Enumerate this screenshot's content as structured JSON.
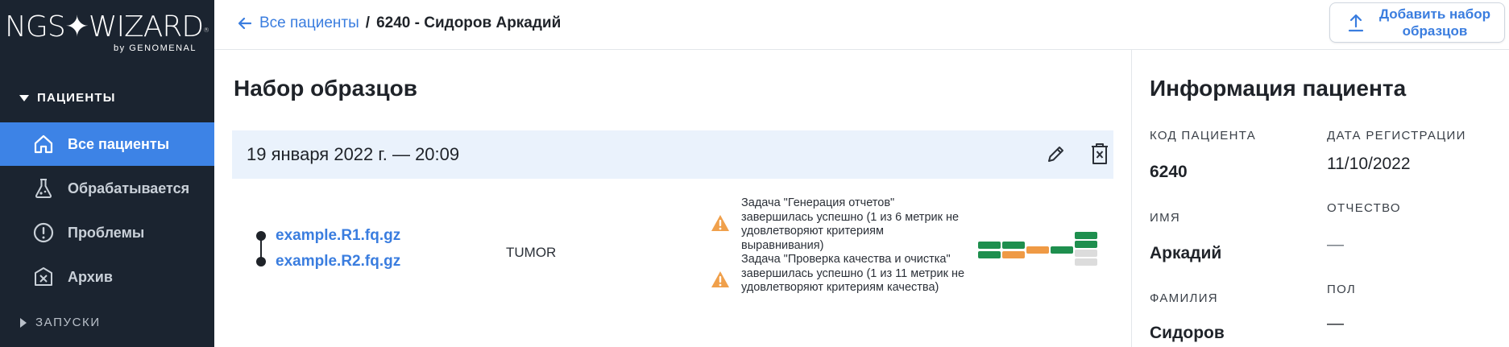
{
  "sidebar": {
    "logo": {
      "main": "NGS✦WIZARD",
      "registered": "®",
      "sub": "by GENOMENAL"
    },
    "section_patients": "ПАЦИЕНТЫ",
    "items": [
      {
        "label": "Все пациенты",
        "icon": "home-icon",
        "active": true
      },
      {
        "label": "Обрабатывается",
        "icon": "flask-icon",
        "active": false
      },
      {
        "label": "Проблемы",
        "icon": "alert-circle-icon",
        "active": false
      },
      {
        "label": "Архив",
        "icon": "archive-icon",
        "active": false
      }
    ],
    "section_runs": "ЗАПУСКИ"
  },
  "header": {
    "breadcrumb_link": "Все пациенты",
    "breadcrumb_sep": "/",
    "breadcrumb_current": "6240 - Сидоров Аркадий",
    "add_button_label": "Добавить набор образцов"
  },
  "main": {
    "title": "Набор образцов",
    "sample_set": {
      "date": "19 января 2022 г. — 20:09",
      "files": [
        "example.R1.fq.gz",
        "example.R2.fq.gz"
      ],
      "sample_type": "TUMOR",
      "tasks": [
        {
          "message": "Задача \"Генерация отчетов\" завершилась успешно (1 из 6 метрик не удовлетворяют критериям выравнивания)"
        },
        {
          "message": "Задача \"Проверка качества и очистка\" завершилась успешно (1 из 11 метрик не удовлетворяют критериям качества)"
        }
      ]
    }
  },
  "patient_info": {
    "title": "Информация пациента",
    "code_label": "КОД ПАЦИЕНТА",
    "code": "6240",
    "registration_label": "ДАТА РЕГИСТРАЦИИ",
    "registration": "11/10/2022",
    "first_name_label": "ИМЯ",
    "first_name": "Аркадий",
    "middle_name_label": "ОТЧЕСТВО",
    "middle_name": "—",
    "last_name_label": "ФАМИЛИЯ",
    "last_name": "Сидоров",
    "sex_label": "ПОЛ",
    "sex": "—"
  },
  "colors": {
    "sidebar_bg": "#1b2430",
    "accent": "#3d83e6",
    "link": "#3a7ddf",
    "sample_header_bg": "#eaf2fc",
    "metric_pass": "#1e8f4e",
    "metric_warn": "#ef9a45",
    "metric_empty": "#dcdcdc",
    "warning_icon": "#f0a04b"
  }
}
